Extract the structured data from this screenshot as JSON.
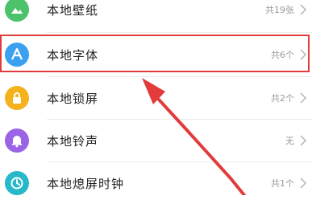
{
  "list": {
    "items": [
      {
        "label": "本地壁纸",
        "count": "共19张",
        "icon": "image-icon",
        "color": "#4cc36b"
      },
      {
        "label": "本地字体",
        "count": "共6个",
        "icon": "font-icon",
        "color": "#3ba0f0"
      },
      {
        "label": "本地锁屏",
        "count": "共2个",
        "icon": "lock-icon",
        "color": "#f5b21c"
      },
      {
        "label": "本地铃声",
        "count": "无",
        "icon": "bell-icon",
        "color": "#9b63e6"
      },
      {
        "label": "本地熄屏时钟",
        "count": "共1个",
        "icon": "clock-icon",
        "color": "#27b9c9"
      }
    ]
  },
  "annotation": {
    "highlight_color": "#e23b3b",
    "arrow_color": "#e23b3b"
  }
}
